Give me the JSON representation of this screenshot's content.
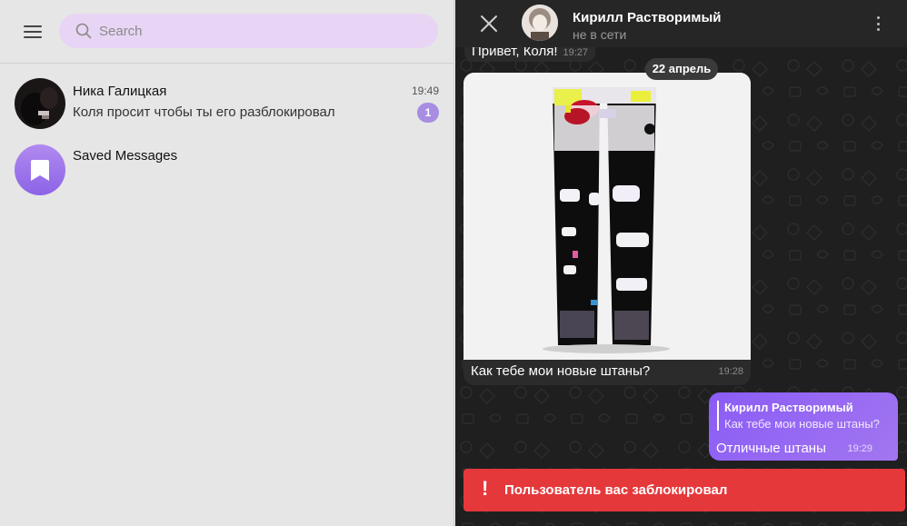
{
  "sidebar": {
    "search": {
      "placeholder": "Search"
    },
    "chats": [
      {
        "name": "Ника Галицкая",
        "preview": "Коля просит чтобы ты его разблокировал",
        "time": "19:49",
        "unread": "1"
      },
      {
        "name": "Saved Messages",
        "preview": "",
        "time": "",
        "unread": ""
      }
    ]
  },
  "chat": {
    "header": {
      "name": "Кирилл Растворимый",
      "status": "не в сети"
    },
    "messages": [
      {
        "text": "Привет, Коля!",
        "time": "19:27"
      },
      {
        "date": "22 апрель"
      },
      {
        "caption": "Как тебе мои новые штаны?",
        "time": "19:28",
        "type": "photo"
      },
      {
        "reply_to_name": "Кирилл Растворимый",
        "reply_to_text": "Как тебе мои новые штаны?",
        "text": "Отличные штаны",
        "time": "19:29",
        "outgoing": true
      }
    ],
    "blocked_banner": {
      "icon": "!",
      "text": "Пользователь вас заблокировал"
    }
  },
  "colors": {
    "accent": "#8b5cf6",
    "badge": "#a88de3",
    "search_bg": "#e8d5f5",
    "blocked": "#e5383b"
  },
  "icons": [
    "menu-icon",
    "search-icon",
    "bookmark-icon",
    "close-icon",
    "kebab-icon",
    "exclamation-icon"
  ]
}
